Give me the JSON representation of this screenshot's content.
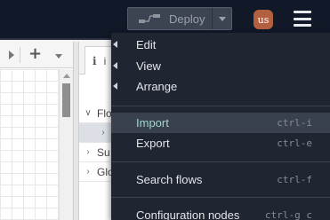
{
  "header": {
    "deploy_label": "Deploy",
    "avatar_initials": "us"
  },
  "workspace": {
    "add_tab_symbol": "+"
  },
  "sidebar": {
    "tab_label": "i",
    "tree": [
      {
        "label": "Flo",
        "chevron": "∨"
      },
      {
        "label": "",
        "chevron": "›"
      },
      {
        "label": "Su",
        "chevron": "›"
      },
      {
        "label": "Glo",
        "chevron": "›"
      }
    ]
  },
  "menu": {
    "items": [
      {
        "label": "Edit",
        "submenu": true
      },
      {
        "label": "View",
        "submenu": true
      },
      {
        "label": "Arrange",
        "submenu": true
      },
      {
        "label": "Import",
        "shortcut": "ctrl-i",
        "active": true
      },
      {
        "label": "Export",
        "shortcut": "ctrl-e"
      },
      {
        "label": "Search flows",
        "shortcut": "ctrl-f"
      },
      {
        "label": "Configuration nodes",
        "shortcut": "ctrl-g c"
      }
    ]
  },
  "colors": {
    "header_bg": "#111827",
    "menu_bg": "#1f2531",
    "menu_active_text": "#9fd6cf",
    "avatar_bg": "#b36040"
  },
  "icons": [
    "deploy-icon",
    "chevron-down-icon",
    "hamburger-menu-icon",
    "info-icon",
    "submenu-arrow-icon"
  ]
}
